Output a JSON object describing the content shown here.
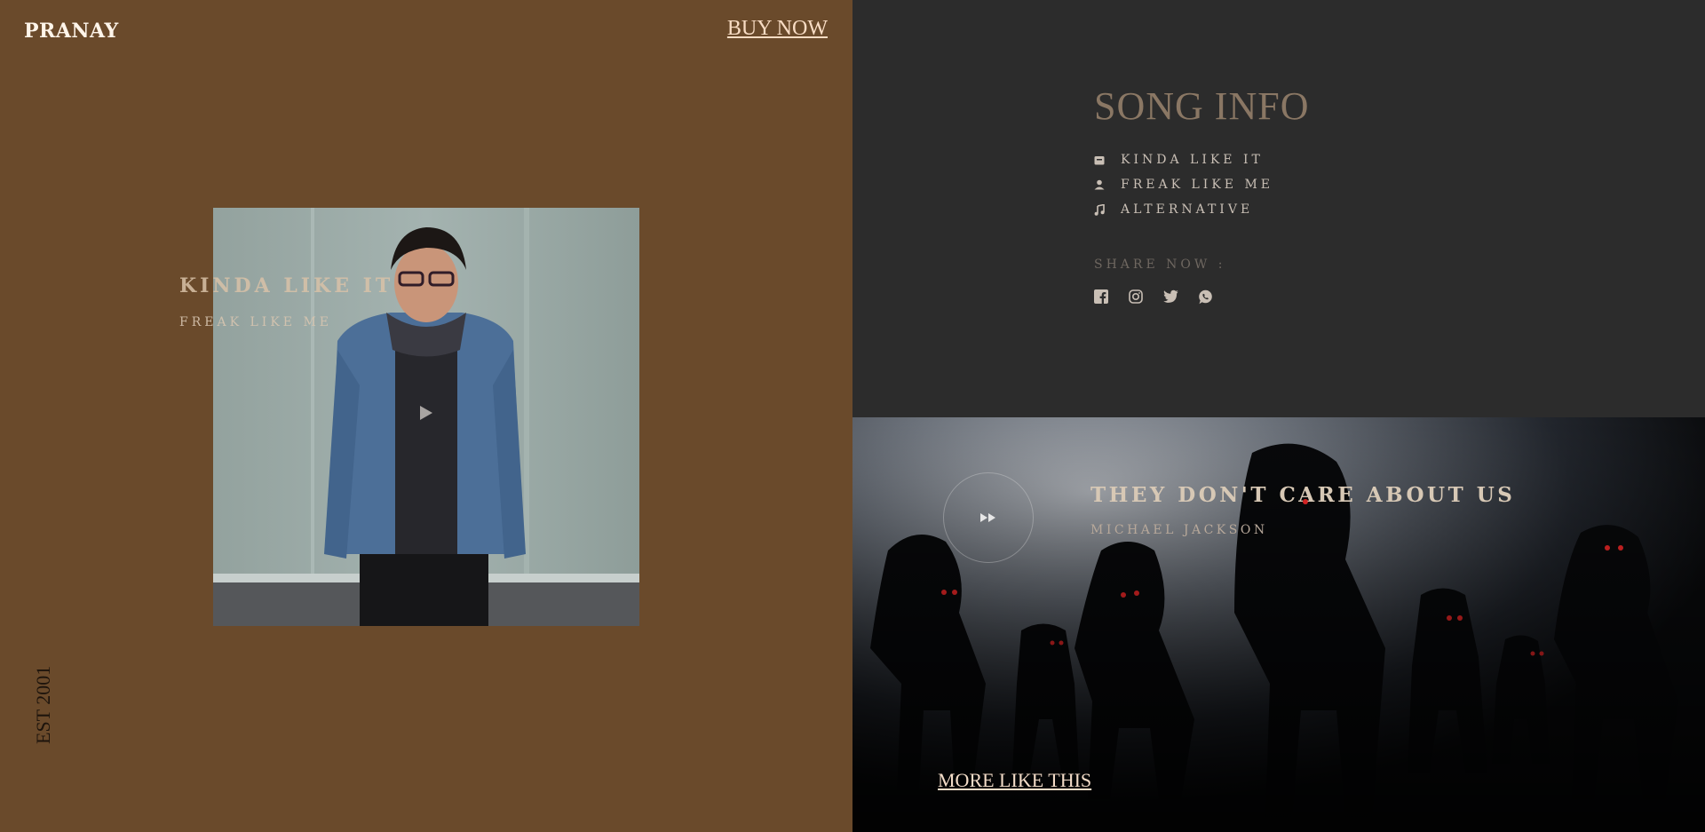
{
  "brand": {
    "name": "PRANAY"
  },
  "header": {
    "buy_now": "BUY NOW"
  },
  "left_panel": {
    "track_title": "KINDA LIKE IT",
    "track_artist": "FREAK LIKE ME",
    "established": "EST 2001",
    "background_color": "#6a4a2b"
  },
  "song_info": {
    "title": "SONG INFO",
    "items": [
      {
        "icon": "album-icon",
        "label": "KINDA LIKE IT"
      },
      {
        "icon": "person-icon",
        "label": "FREAK LIKE ME"
      },
      {
        "icon": "music-note-icon",
        "label": "ALTERNATIVE"
      }
    ],
    "share_label": "SHARE NOW :",
    "socials": [
      "facebook-icon",
      "instagram-icon",
      "twitter-icon",
      "whatsapp-icon"
    ]
  },
  "feature": {
    "title": "THEY DON'T CARE ABOUT US",
    "artist": "MICHAEL JACKSON",
    "more_link": "MORE LIKE THIS"
  }
}
